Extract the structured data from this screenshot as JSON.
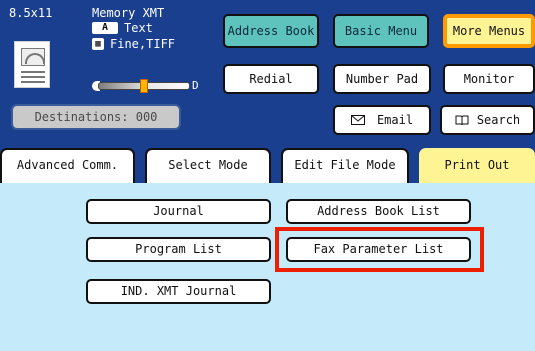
{
  "status": {
    "paper_size": "8.5x11",
    "transmit_mode": "Memory XMT",
    "original_type": "Text",
    "resolution": "Fine,TIFF",
    "contrast_level": 0.5,
    "destinations_label": "Destinations: 000"
  },
  "menus": {
    "address_book": "Address Book",
    "basic_menu": "Basic Menu",
    "more_menus": "More Menus"
  },
  "toolbar": {
    "redial": "Redial",
    "number_pad": "Number Pad",
    "monitor": "Monitor",
    "email": "Email",
    "search": "Search"
  },
  "tabs": [
    "Advanced Comm.",
    "Select Mode",
    "Edit File Mode",
    "Print Out"
  ],
  "selected_tab": "Print Out",
  "print_out": {
    "journal": "Journal",
    "address_book_list": "Address Book List",
    "program_list": "Program List",
    "fax_parameter_list": "Fax Parameter List",
    "ind_xmt_journal": "IND. XMT Journal"
  },
  "highlighted_button": "Fax Parameter List",
  "colors": {
    "top_background": "#1a3f8f",
    "panel_background": "#c5ebfa",
    "teal_button": "#5ec2bd",
    "selected": "#fff494",
    "highlight": "#ee1f00"
  }
}
